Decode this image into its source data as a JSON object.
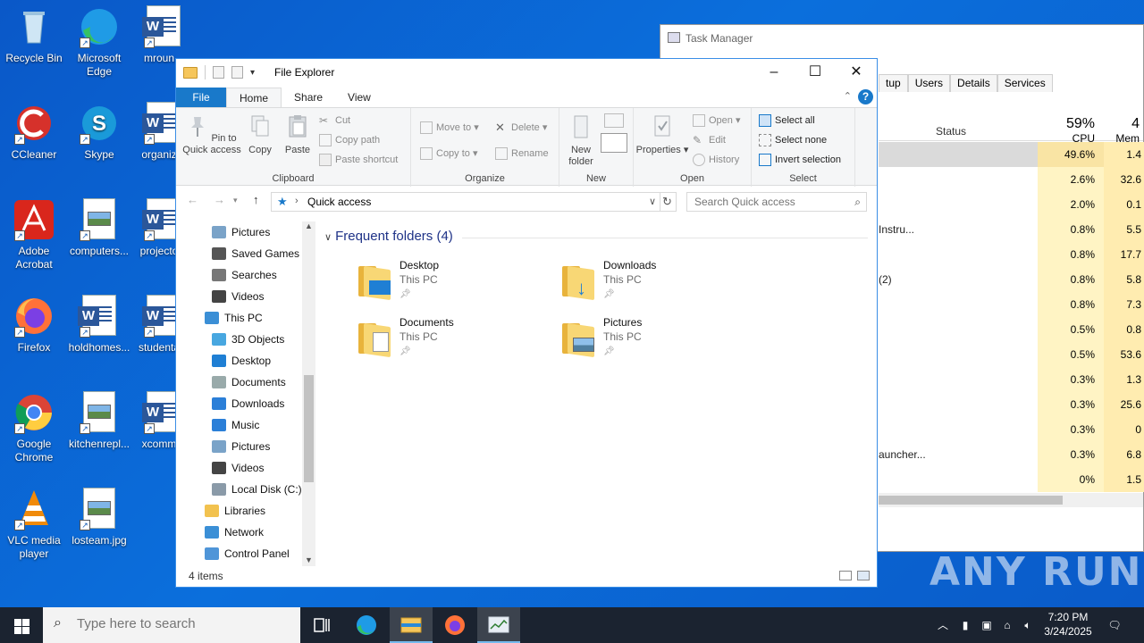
{
  "desktop": {
    "icons": [
      {
        "label": "Recycle Bin",
        "icon": "recycle-bin-icon"
      },
      {
        "label": "Microsoft Edge",
        "icon": "edge-icon"
      },
      {
        "label": "mroun...",
        "icon": "word-doc-icon"
      },
      {
        "label": "CCleaner",
        "icon": "ccleaner-icon"
      },
      {
        "label": "Skype",
        "icon": "skype-icon"
      },
      {
        "label": "organiz...",
        "icon": "word-doc-icon"
      },
      {
        "label": "Adobe Acrobat",
        "icon": "acrobat-icon"
      },
      {
        "label": "computers...",
        "icon": "image-file-icon"
      },
      {
        "label": "projecto...",
        "icon": "word-doc-icon"
      },
      {
        "label": "Firefox",
        "icon": "firefox-icon"
      },
      {
        "label": "holdhomes...",
        "icon": "word-doc-icon"
      },
      {
        "label": "studenta...",
        "icon": "word-doc-icon"
      },
      {
        "label": "Google Chrome",
        "icon": "chrome-icon"
      },
      {
        "label": "kitchenrepl...",
        "icon": "image-file-icon"
      },
      {
        "label": "xcomm...",
        "icon": "word-doc-icon"
      },
      {
        "label": "VLC media player",
        "icon": "vlc-icon"
      },
      {
        "label": "losteam.jpg",
        "icon": "image-file-icon"
      }
    ]
  },
  "task_manager": {
    "title": "Task Manager",
    "tabs": [
      "tup",
      "Users",
      "Details",
      "Services"
    ],
    "columns": {
      "status": "Status",
      "cpu_pct": "59%",
      "cpu": "CPU",
      "mem_pct": "4",
      "mem": "Mem"
    },
    "rows": [
      {
        "name": "",
        "cpu": "49.6%",
        "mem": "1.4"
      },
      {
        "name": "",
        "cpu": "2.6%",
        "mem": "32.6"
      },
      {
        "name": "",
        "cpu": "2.0%",
        "mem": "0.1"
      },
      {
        "name": "Instru...",
        "cpu": "0.8%",
        "mem": "5.5"
      },
      {
        "name": "",
        "cpu": "0.8%",
        "mem": "17.7"
      },
      {
        "name": "(2)",
        "cpu": "0.8%",
        "mem": "5.8"
      },
      {
        "name": "",
        "cpu": "0.8%",
        "mem": "7.3"
      },
      {
        "name": "",
        "cpu": "0.5%",
        "mem": "0.8"
      },
      {
        "name": "",
        "cpu": "0.5%",
        "mem": "53.6"
      },
      {
        "name": "",
        "cpu": "0.3%",
        "mem": "1.3"
      },
      {
        "name": "",
        "cpu": "0.3%",
        "mem": "25.6"
      },
      {
        "name": "",
        "cpu": "0.3%",
        "mem": "0"
      },
      {
        "name": "auncher...",
        "cpu": "0.3%",
        "mem": "6.8"
      },
      {
        "name": "",
        "cpu": "0%",
        "mem": "1.5"
      }
    ]
  },
  "explorer": {
    "title": "File Explorer",
    "ribbon_tabs": {
      "file": "File",
      "home": "Home",
      "share": "Share",
      "view": "View"
    },
    "clipboard": {
      "pin": "Pin to Quick access",
      "copy": "Copy",
      "paste": "Paste",
      "cut": "Cut",
      "copy_path": "Copy path",
      "paste_shortcut": "Paste shortcut",
      "label": "Clipboard"
    },
    "organize": {
      "move_to": "Move to",
      "copy_to": "Copy to",
      "delete": "Delete",
      "rename": "Rename",
      "label": "Organize"
    },
    "new": {
      "new_folder": "New folder",
      "label": "New"
    },
    "open": {
      "properties": "Properties",
      "open": "Open",
      "edit": "Edit",
      "history": "History",
      "label": "Open"
    },
    "select": {
      "select_all": "Select all",
      "select_none": "Select none",
      "invert": "Invert selection",
      "label": "Select"
    },
    "address": "Quick access",
    "search_placeholder": "Search Quick access",
    "nav_items": [
      {
        "label": "Pictures",
        "icon": "pictures-icon",
        "indent": 1
      },
      {
        "label": "Saved Games",
        "icon": "saved-games-icon",
        "indent": 1
      },
      {
        "label": "Searches",
        "icon": "searches-icon",
        "indent": 1
      },
      {
        "label": "Videos",
        "icon": "videos-icon",
        "indent": 1
      },
      {
        "label": "This PC",
        "icon": "this-pc-icon",
        "indent": 0
      },
      {
        "label": "3D Objects",
        "icon": "3d-objects-icon",
        "indent": 1
      },
      {
        "label": "Desktop",
        "icon": "desktop-icon",
        "indent": 1
      },
      {
        "label": "Documents",
        "icon": "documents-icon",
        "indent": 1
      },
      {
        "label": "Downloads",
        "icon": "downloads-icon",
        "indent": 1
      },
      {
        "label": "Music",
        "icon": "music-icon",
        "indent": 1
      },
      {
        "label": "Pictures",
        "icon": "pictures-icon",
        "indent": 1
      },
      {
        "label": "Videos",
        "icon": "videos-icon",
        "indent": 1
      },
      {
        "label": "Local Disk (C:)",
        "icon": "local-disk-icon",
        "indent": 1
      },
      {
        "label": "Libraries",
        "icon": "libraries-icon",
        "indent": 0
      },
      {
        "label": "Network",
        "icon": "network-icon",
        "indent": 0
      },
      {
        "label": "Control Panel",
        "icon": "control-panel-icon",
        "indent": 0
      }
    ],
    "group_header": "Frequent folders (4)",
    "folders": [
      {
        "name": "Desktop",
        "location": "This PC",
        "icon": "desktop-folder-icon"
      },
      {
        "name": "Downloads",
        "location": "This PC",
        "icon": "downloads-folder-icon"
      },
      {
        "name": "Documents",
        "location": "This PC",
        "icon": "documents-folder-icon"
      },
      {
        "name": "Pictures",
        "location": "This PC",
        "icon": "pictures-folder-icon"
      }
    ],
    "status": "4 items"
  },
  "watermark": "ANY RUN",
  "taskbar": {
    "search_placeholder": "Type here to search",
    "time": "7:20 PM",
    "date": "3/24/2025"
  }
}
